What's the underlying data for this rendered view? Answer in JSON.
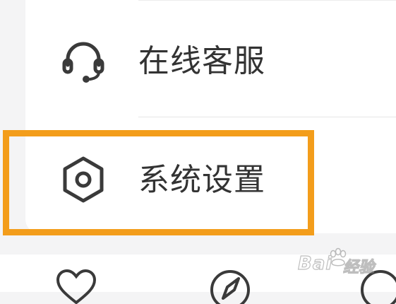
{
  "menu": {
    "items": [
      {
        "label": "在线客服",
        "icon": "headset-icon"
      },
      {
        "label": "系统设置",
        "icon": "hexagon-settings-icon",
        "highlighted": true
      }
    ]
  },
  "bottom_nav": {
    "icons": [
      "heart-icon",
      "compass-icon",
      "profile-icon"
    ]
  },
  "watermark": {
    "brand": "Bai",
    "sub": "经验"
  },
  "colors": {
    "highlight": "#f39d1b",
    "icon": "#3a3a3a",
    "text": "#333333",
    "background": "#f4f4f5"
  }
}
